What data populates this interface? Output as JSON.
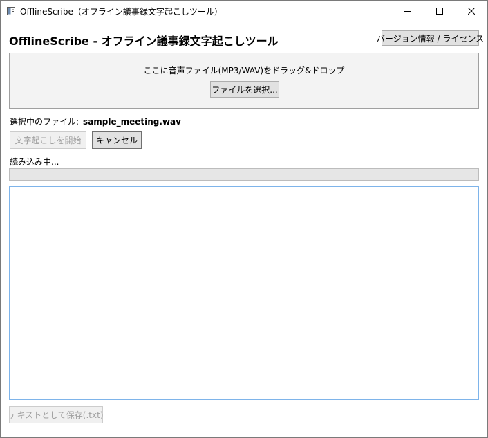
{
  "window": {
    "title": "OfflineScribe（オフライン議事録文字起こしツール）"
  },
  "header": {
    "heading": "OfflineScribe - オフライン議事録文字起こしツール",
    "version_button": "バージョン情報 / ライセンス"
  },
  "drop_zone": {
    "text": "ここに音声ファイル(MP3/WAV)をドラッグ&ドロップ",
    "select_button": "ファイルを選択..."
  },
  "file": {
    "label": "選択中のファイル:",
    "name": "sample_meeting.wav"
  },
  "actions": {
    "start_button": "文字起こしを開始",
    "cancel_button": "キャンセル",
    "save_button": "テキストとして保存(.txt)"
  },
  "status": {
    "text": "読み込み中...",
    "progress": 0
  },
  "output": {
    "text": ""
  },
  "colors": {
    "accent_border": "#7eb4ea"
  }
}
